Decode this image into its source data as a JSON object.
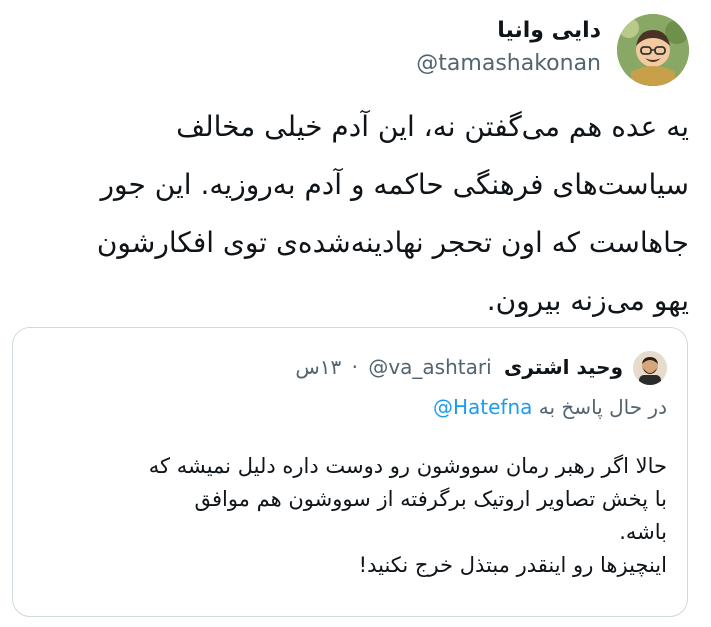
{
  "tweet": {
    "display_name": "دایی وانیا",
    "handle": "@tamashakonan",
    "text_lines": [
      "یه عده هم می‌گفتن نه، این آدم خیلی مخالف",
      "سیاست‌های فرهنگی حاکمه و آدم به‌روزیه. این جور",
      "جاهاست که اون تحجر نهادینه‌شده‌ی توی افکارشون",
      "یهو می‌زنه بیرون."
    ]
  },
  "quoted_tweet": {
    "display_name": "وحید اشتری",
    "handle": "@va_ashtari",
    "separator": "·",
    "time": "۱۳س",
    "reply_prefix": "در حال پاسخ به",
    "reply_handle": "@Hatefna",
    "text_lines": [
      "حالا اگر رهبر رمان سووشون رو دوست داره دلیل نمیشه که",
      "با پخش تصاویر اروتیک برگرفته از سووشون هم موافق",
      "باشه.",
      "اینچیزها رو اینقدر مبتذل خرج نکنید!"
    ]
  },
  "colors": {
    "primary_text": "#0f1419",
    "secondary_text": "#536471",
    "link": "#1d9bf0",
    "border": "#cfd9de"
  },
  "icons": {
    "main_avatar": "avatar-cartoon-man-icon",
    "quote_avatar": "avatar-man-beard-icon"
  }
}
